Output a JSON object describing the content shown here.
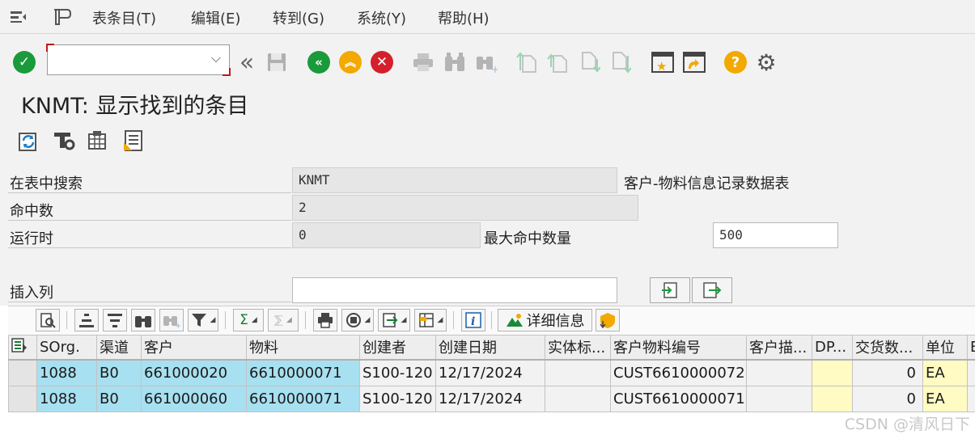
{
  "menu": {
    "items": [
      "表条目(T)",
      "编辑(E)",
      "转到(G)",
      "系统(Y)",
      "帮助(H)"
    ]
  },
  "toolbar": {
    "command_value": "",
    "icons": [
      "enter-icon",
      "save-icon",
      "back-icon",
      "exit-icon",
      "cancel-icon",
      "print-icon",
      "find-icon",
      "find-next-icon",
      "first-page-icon",
      "previous-page-icon",
      "next-page-icon",
      "last-page-icon",
      "create-session-icon",
      "shortcut-icon",
      "help-icon",
      "customize-layout-icon"
    ],
    "colors": {
      "enter": "#1a9a3a",
      "back": "#1a9a3a",
      "exit": "#f2a900",
      "cancel": "#d4202c",
      "help": "#f2a900"
    }
  },
  "page": {
    "title": "KNMT: 显示找到的条目"
  },
  "form": {
    "table_label": "在表中搜索",
    "table_value": "KNMT",
    "table_description": "客户-物料信息记录数据表",
    "hits_label": "命中数",
    "hits_value": "2",
    "runtime_label": "运行时",
    "runtime_value": "0",
    "max_hits_label": "最大命中数量",
    "max_hits_value": "500",
    "insert_col_label": "插入列",
    "insert_col_value": ""
  },
  "alv": {
    "details_label": "详细信息"
  },
  "table": {
    "columns": [
      "SOrg.",
      "渠道",
      "客户",
      "物料",
      "创建者",
      "创建日期",
      "实体标...",
      "客户物料编号",
      "客户描...",
      "DP...",
      "交货数...",
      "单位",
      "B"
    ],
    "rows": [
      [
        "1088",
        "B0",
        "661000020",
        "6610000071",
        "S100-120",
        "12/17/2024",
        "",
        "CUST6610000072",
        "",
        "",
        "0",
        "EA",
        ""
      ],
      [
        "1088",
        "B0",
        "661000060",
        "6610000071",
        "S100-120",
        "12/17/2024",
        "",
        "CUST6610000071",
        "",
        "",
        "0",
        "EA",
        ""
      ]
    ]
  },
  "watermark": "CSDN @清风日下"
}
